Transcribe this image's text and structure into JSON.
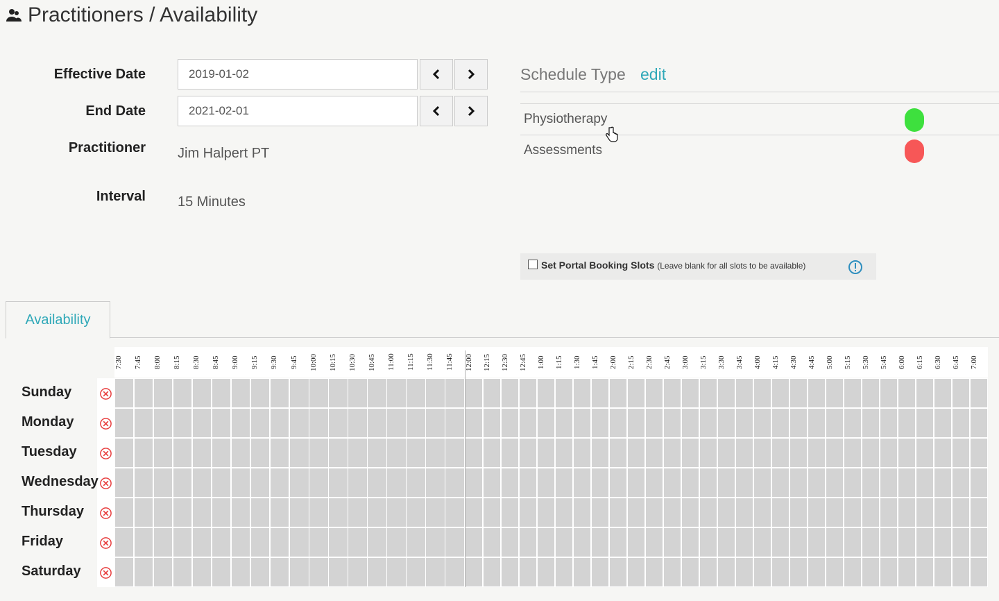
{
  "header": {
    "title": "Practitioners / Availability",
    "icon": "users-icon"
  },
  "form": {
    "effective_date_label": "Effective Date",
    "effective_date_value": "2019-01-02",
    "end_date_label": "End Date",
    "end_date_value": "2021-02-01",
    "practitioner_label": "Practitioner",
    "practitioner_value": "Jim Halpert PT",
    "interval_label": "Interval",
    "interval_value": "15 Minutes"
  },
  "schedule_type": {
    "header": "Schedule Type",
    "edit_label": "edit",
    "items": [
      {
        "label": "Physiotherapy",
        "color": "#3ee03e"
      },
      {
        "label": "Assessments",
        "color": "#f75757"
      }
    ]
  },
  "portal": {
    "checked": false,
    "label": "Set Portal Booking Slots",
    "note": "(Leave blank for all slots to be available)",
    "info_icon": "info-icon"
  },
  "tabs": [
    {
      "label": "Availability",
      "active": true
    }
  ],
  "grid": {
    "times": [
      "7:30",
      "7:45",
      "8:00",
      "8:15",
      "8:30",
      "8:45",
      "9:00",
      "9:15",
      "9:30",
      "9:45",
      "10:00",
      "10:15",
      "10:30",
      "10:45",
      "11:00",
      "11:15",
      "11:30",
      "11:45",
      "12:00",
      "12:15",
      "12:30",
      "12:45",
      "1:00",
      "1:15",
      "1:30",
      "1:45",
      "2:00",
      "2:15",
      "2:30",
      "2:45",
      "3:00",
      "3:15",
      "3:30",
      "3:45",
      "4:00",
      "4:15",
      "4:30",
      "4:45",
      "5:00",
      "5:15",
      "5:30",
      "5:45",
      "6:00",
      "6:15",
      "6:30",
      "6:45",
      "7:00"
    ],
    "days": [
      "Sunday",
      "Monday",
      "Tuesday",
      "Wednesday",
      "Thursday",
      "Friday",
      "Saturday"
    ],
    "cell_color": "#d3d3d3",
    "accent": "#2fa8b8",
    "clear_color": "#e84040"
  }
}
